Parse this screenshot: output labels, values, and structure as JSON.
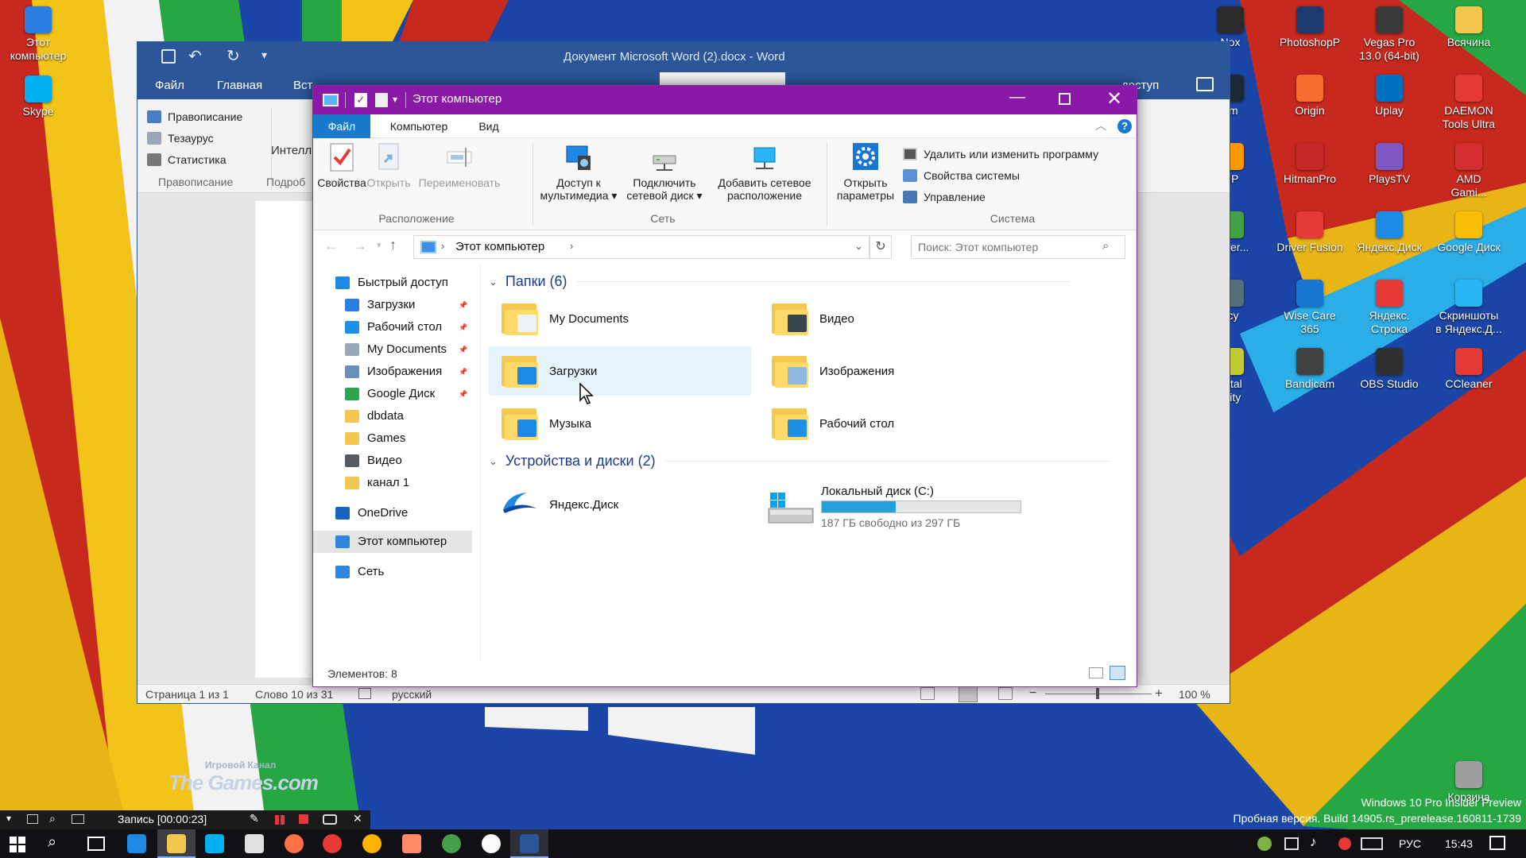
{
  "word": {
    "title": "Документ Microsoft Word (2).docx - Word",
    "tabs": [
      "Файл",
      "Главная",
      "Вст"
    ],
    "tab_fragment_right": "доступ",
    "ribbon_spelling": "Правописание",
    "ribbon_thesaurus": "Тезаурус",
    "ribbon_stats": "Статистика",
    "ribbon_group_spelling": "Правописание",
    "ribbon_intel": "Интелл",
    "ribbon_group_more": "Подроб",
    "status_page": "Страница 1 из 1",
    "status_words": "Слово 10 из 31",
    "status_lang": "русский",
    "zoom": "100 %"
  },
  "explorer": {
    "title": "Этот компьютер",
    "tabs": {
      "file": "Файл",
      "computer": "Компьютер",
      "view": "Вид"
    },
    "ribbon": {
      "props": "Свойства",
      "open": "Открыть",
      "rename": "Переименовать",
      "group_location": "Расположение",
      "media_1": "Доступ к",
      "media_2": "мультимедиа",
      "map_1": "Подключить",
      "map_2": "сетевой диск",
      "addnet_1": "Добавить сетевое",
      "addnet_2": "расположение",
      "group_network": "Сеть",
      "settings_1": "Открыть",
      "settings_2": "параметры",
      "uninstall": "Удалить или изменить программу",
      "sysprops": "Свойства системы",
      "manage": "Управление",
      "group_system": "Система"
    },
    "nav": {
      "path": "Этот компьютер",
      "search_placeholder": "Поиск: Этот компьютер"
    },
    "sidebar": [
      {
        "label": "Быстрый доступ",
        "icon": "star-icon",
        "color": "#1e88e5",
        "pinned": false,
        "indent": 0
      },
      {
        "label": "Загрузки",
        "icon": "download-icon",
        "color": "#2a7de1",
        "pinned": true,
        "indent": 1
      },
      {
        "label": "Рабочий стол",
        "icon": "desktop-icon",
        "color": "#1e90e6",
        "pinned": true,
        "indent": 1
      },
      {
        "label": "My Documents",
        "icon": "document-icon",
        "color": "#9aa6b8",
        "pinned": true,
        "indent": 1
      },
      {
        "label": "Изображения",
        "icon": "pictures-icon",
        "color": "#6a8fb8",
        "pinned": true,
        "indent": 1
      },
      {
        "label": "Google Диск",
        "icon": "google-drive-icon",
        "color": "#2ea44f",
        "pinned": true,
        "indent": 1
      },
      {
        "label": "dbdata",
        "icon": "folder-icon",
        "color": "#f3c74c",
        "pinned": false,
        "indent": 1
      },
      {
        "label": "Games",
        "icon": "folder-icon",
        "color": "#f3c74c",
        "pinned": false,
        "indent": 1
      },
      {
        "label": "Видео",
        "icon": "video-icon",
        "color": "#555b66",
        "pinned": false,
        "indent": 1
      },
      {
        "label": "канал 1",
        "icon": "folder-icon",
        "color": "#f3c74c",
        "pinned": false,
        "indent": 1
      },
      {
        "label": "OneDrive",
        "icon": "onedrive-icon",
        "color": "#1565c0",
        "pinned": false,
        "indent": 0
      },
      {
        "label": "Этот компьютер",
        "icon": "computer-icon",
        "color": "#2e86de",
        "pinned": false,
        "indent": 0,
        "selected": true
      },
      {
        "label": "Сеть",
        "icon": "network-icon",
        "color": "#2e86de",
        "pinned": false,
        "indent": 0
      }
    ],
    "folders_header": "Папки (6)",
    "folders": [
      {
        "label": "My Documents",
        "icon": "documents-folder-icon"
      },
      {
        "label": "Видео",
        "icon": "video-folder-icon"
      },
      {
        "label": "Загрузки",
        "icon": "downloads-folder-icon",
        "selected": true
      },
      {
        "label": "Изображения",
        "icon": "pictures-folder-icon"
      },
      {
        "label": "Музыка",
        "icon": "music-folder-icon"
      },
      {
        "label": "Рабочий стол",
        "icon": "desktop-folder-icon"
      }
    ],
    "devices_header": "Устройства и диски (2)",
    "yandex_disk": "Яндекс.Диск",
    "drive_c_label": "Локальный диск (C:)",
    "drive_c_free": "187 ГБ свободно из 297 ГБ",
    "drive_c_used_fraction": 0.37,
    "status_items": "Элементов: 8"
  },
  "desktop_icons": [
    {
      "label_lines": [
        "Этот",
        "компьютер"
      ],
      "color": "#2a7de1"
    },
    {
      "label_lines": [
        "Skype"
      ],
      "color": "#00aff0"
    },
    {
      "label_lines": [
        "Nox"
      ],
      "color": "#2b2b2b"
    },
    {
      "label_lines": [
        "PhotoshopP"
      ],
      "color": "#1d3b6e"
    },
    {
      "label_lines": [
        "Vegas Pro",
        "13.0 (64-bit)"
      ],
      "color": "#3a3a3a"
    },
    {
      "label_lines": [
        "Всячина"
      ],
      "color": "#f3c74c"
    },
    {
      "label_lines": [
        "am"
      ],
      "color": "#1b2838"
    },
    {
      "label_lines": [
        "Origin"
      ],
      "color": "#f56c2d"
    },
    {
      "label_lines": [
        "Uplay"
      ],
      "color": "#0070c0"
    },
    {
      "label_lines": [
        "DAEMON",
        "Tools Ultra"
      ],
      "color": "#e53935"
    },
    {
      "label_lines": [
        "MP"
      ],
      "color": "#ff9800"
    },
    {
      "label_lines": [
        "HitmanPro"
      ],
      "color": "#c62828"
    },
    {
      "label_lines": [
        "PlaysTV"
      ],
      "color": "#7e57c2"
    },
    {
      "label_lines": [
        "AMD",
        "Gami..."
      ],
      "color": "#d32f2f"
    },
    {
      "label_lines": [
        "eaner..."
      ],
      "color": "#43a047"
    },
    {
      "label_lines": [
        "Driver Fusion"
      ],
      "color": "#e53935"
    },
    {
      "label_lines": [
        "Яндекс.Диск"
      ],
      "color": "#1e88e5"
    },
    {
      "label_lines": [
        "Google Диск"
      ],
      "color": "#fbbc04"
    },
    {
      "label_lines": [
        "ccy"
      ],
      "color": "#546e7a"
    },
    {
      "label_lines": [
        "Wise Care",
        "365"
      ],
      "color": "#1976d2"
    },
    {
      "label_lines": [
        "Яндекс.",
        "Строка"
      ],
      "color": "#e53935"
    },
    {
      "label_lines": [
        "Скриншоты",
        "в Яндекс.Д..."
      ],
      "color": "#29b6f6"
    },
    {
      "label_lines": [
        "Total",
        "urity"
      ],
      "color": "#c0ca33"
    },
    {
      "label_lines": [
        "Bandicam"
      ],
      "color": "#424242"
    },
    {
      "label_lines": [
        "OBS Studio"
      ],
      "color": "#303030"
    },
    {
      "label_lines": [
        "CCleaner"
      ],
      "color": "#e53935"
    },
    {
      "label_lines": [
        "Корзина"
      ],
      "color": "#9e9e9e"
    }
  ],
  "watermark": {
    "small": "Игровой Канал",
    "big": "The Games.com"
  },
  "recorder": {
    "text": "Запись [00:00:23]"
  },
  "os_watermark": {
    "line1": "Windows 10 Pro Insider Preview",
    "line2": "Пробная версия. Build 14905.rs_prerelease.160811-1739"
  },
  "taskbar": {
    "lang": "РУС",
    "time": "15:43"
  }
}
